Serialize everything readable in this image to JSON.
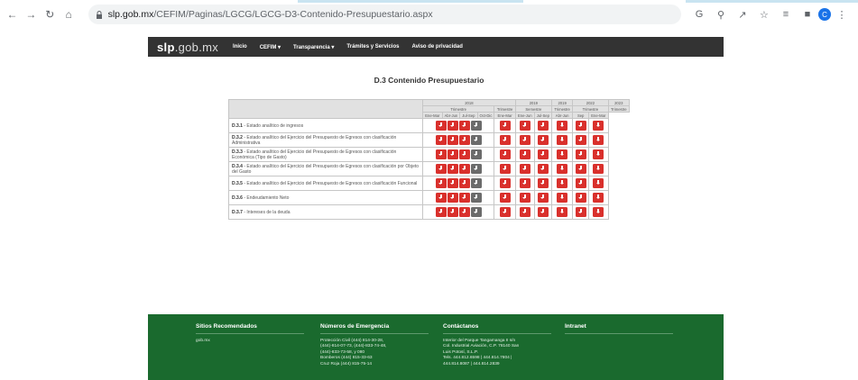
{
  "browser": {
    "url_domain": "slp.gob.mx",
    "url_path": "/CEFIM/Paginas/LGCG/LGCG-D3-Contenido-Presupuestario.aspx",
    "avatar_letter": "C"
  },
  "nav": {
    "logo_main": "slp",
    "logo_rest": ".gob.mx",
    "items": [
      "Inicio",
      "CEFIM ▾",
      "Transparencia ▾",
      "Trámites y Servicios",
      "Aviso de privacidad"
    ]
  },
  "page": {
    "title": "D.3 Contenido Presupuestario"
  },
  "table": {
    "years": [
      "2018",
      "2019",
      "2022",
      "2023"
    ],
    "period_groups": [
      "Trimestre",
      "Trimestre",
      "Semestre",
      "Trimestre",
      "Trimestre",
      "Trimestre"
    ],
    "sub_periods": [
      "Ene-Mar",
      "Abr-Jun",
      "Jul-Sep",
      "Oct-Dic",
      "Ene-Mar",
      "Ene-Jun",
      "Jul-Sep",
      "Abr-Jun",
      "Sep",
      "Ene-Mar"
    ],
    "rows": [
      {
        "code": "D.3.1",
        "label": " - Estado analítico de ingresos"
      },
      {
        "code": "D.3.2",
        "label": " - Estado analítico del Ejercicio del Presupuesto de Egresos con clasificación Administrativa"
      },
      {
        "code": "D.3.3",
        "label": " - Estado analítico del Ejercicio del Presupuesto de Egresos con clasificación Económica (Tipo de Gasto)"
      },
      {
        "code": "D.3.4",
        "label": " - Estado analítico del Ejercicio del Presupuesto de Egresos con clasificación por Objeto del Gasto"
      },
      {
        "code": "D.3.5",
        "label": " - Estado analítico del Ejercicio del Presupuesto de Egresos con clasificación Funcional"
      },
      {
        "code": "D.3.6",
        "label": " - Endeudamiento Neto"
      },
      {
        "code": "D.3.7",
        "label": " - Intereses de la deuda"
      }
    ]
  },
  "footer": {
    "col1": {
      "title": "Sitios Recomendados",
      "text": "gob.mx"
    },
    "col2": {
      "title": "Números de Emergencia",
      "text": "Protección Civil (444) 814-30-28,\n(444)-814-07-73, (444)-833-74-48,\n(444)-833-73-58, y 080\nBomberos (444) 815-33-63\nCruz Roja (444) 815-75-14"
    },
    "col3": {
      "title": "Contáctanos",
      "text": "Interior del Parque Tangamanga II s/n\nCol. Industrial Aviación, C.P. 78140 San\nLuis Potosí, S.L.P.\nTels. 444.812.6598 | 444.814.7804 |\n444.814.8087 | 444.814.2839"
    },
    "col4": {
      "title": "Intranet",
      "text": ""
    }
  },
  "colors": {
    "nav_bg": "#333333",
    "footer_bg": "#1a6a2e",
    "download_red": "#d9302c",
    "download_gray": "#6b6b6b"
  }
}
